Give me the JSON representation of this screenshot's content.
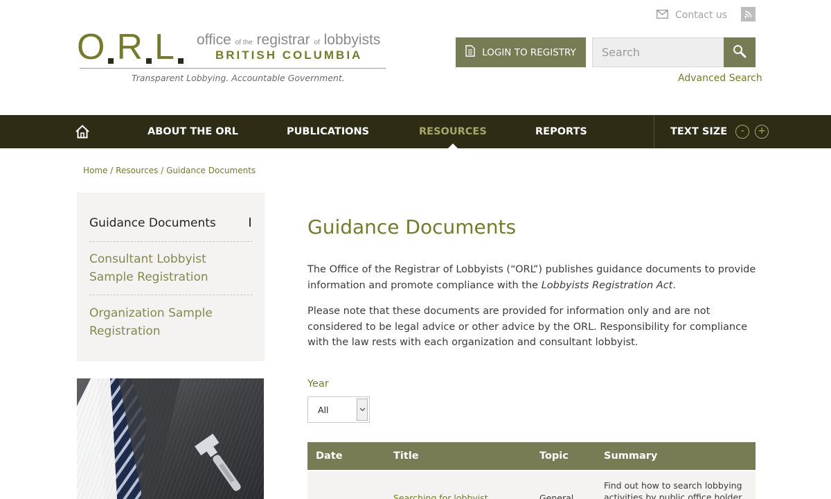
{
  "header": {
    "logo": {
      "letters": [
        "O",
        "R",
        "L"
      ],
      "office_words": [
        "office",
        "of the",
        "registrar",
        "of",
        "lobbyists"
      ],
      "province": "BRITISH COLUMBIA",
      "tagline": "Transparent Lobbying. Accountable Government."
    },
    "contact_label": "Contact us",
    "login_label": "LOGIN TO REGISTRY",
    "search_placeholder": "Search",
    "advanced_search": "Advanced Search"
  },
  "nav": {
    "items": [
      {
        "label": "ABOUT THE ORL",
        "active": false
      },
      {
        "label": "PUBLICATIONS",
        "active": false
      },
      {
        "label": "RESOURCES",
        "active": true
      },
      {
        "label": "REPORTS",
        "active": false
      }
    ],
    "text_size_label": "TEXT SIZE",
    "decrease_symbol": "-",
    "increase_symbol": "+"
  },
  "breadcrumb": {
    "items": [
      "Home",
      "Resources",
      "Guidance Documents"
    ],
    "separator": "/"
  },
  "sidebar": {
    "items": [
      {
        "label": "Guidance Documents",
        "current": true
      },
      {
        "label": "Consultant Lobbyist Sample Registration",
        "current": false
      },
      {
        "label": "Organization Sample Registration",
        "current": false
      }
    ]
  },
  "main": {
    "title": "Guidance Documents",
    "intro_part1": "The Office of the Registrar of Lobbyists (“ORL”) publishes guidance documents to provide information and promote compliance with the ",
    "intro_act": "Lobbyists Registration Act",
    "intro_end": ".",
    "note": "Please note that these documents are provided for information only and are not considered to be legal advice or other advice by the ORL. Responsibility for compliance with the law rests with each organization and consultant lobbyist.",
    "filter": {
      "label": "Year",
      "selected": "All"
    },
    "table": {
      "headers": [
        "Date",
        "Title",
        "Topic",
        "Summary"
      ],
      "rows": [
        {
          "date": "",
          "title": "Searching for lobbyist",
          "topic": "General",
          "summary": "Find out how to search lobbying activities by public office holder"
        }
      ]
    }
  },
  "colors": {
    "brand_olive": "#757a2d",
    "button_olive": "#777c54",
    "nav_background": "#2e2c15",
    "active_nav": "#a5a86a",
    "panel_background": "#f4f3f2"
  },
  "icons": [
    "envelope-icon",
    "rss-icon",
    "document-icon",
    "search-icon",
    "home-icon",
    "chevron-down-icon"
  ]
}
